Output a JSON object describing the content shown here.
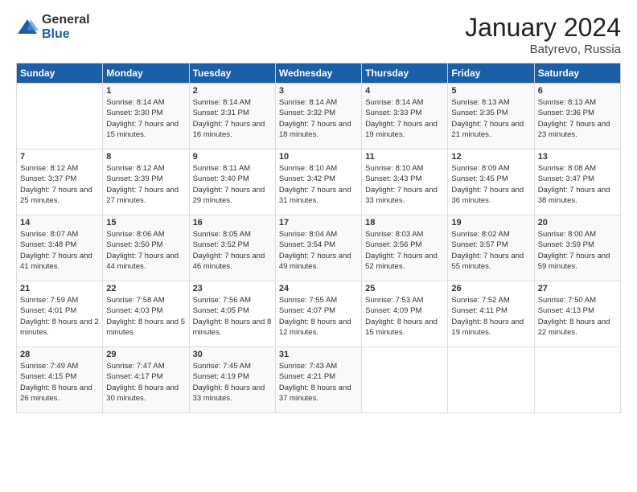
{
  "logo": {
    "general": "General",
    "blue": "Blue"
  },
  "header": {
    "month": "January 2024",
    "location": "Batyrevo, Russia"
  },
  "days_of_week": [
    "Sunday",
    "Monday",
    "Tuesday",
    "Wednesday",
    "Thursday",
    "Friday",
    "Saturday"
  ],
  "weeks": [
    [
      {
        "day": "",
        "sunrise": "",
        "sunset": "",
        "daylight": ""
      },
      {
        "day": "1",
        "sunrise": "Sunrise: 8:14 AM",
        "sunset": "Sunset: 3:30 PM",
        "daylight": "Daylight: 7 hours and 15 minutes."
      },
      {
        "day": "2",
        "sunrise": "Sunrise: 8:14 AM",
        "sunset": "Sunset: 3:31 PM",
        "daylight": "Daylight: 7 hours and 16 minutes."
      },
      {
        "day": "3",
        "sunrise": "Sunrise: 8:14 AM",
        "sunset": "Sunset: 3:32 PM",
        "daylight": "Daylight: 7 hours and 18 minutes."
      },
      {
        "day": "4",
        "sunrise": "Sunrise: 8:14 AM",
        "sunset": "Sunset: 3:33 PM",
        "daylight": "Daylight: 7 hours and 19 minutes."
      },
      {
        "day": "5",
        "sunrise": "Sunrise: 8:13 AM",
        "sunset": "Sunset: 3:35 PM",
        "daylight": "Daylight: 7 hours and 21 minutes."
      },
      {
        "day": "6",
        "sunrise": "Sunrise: 8:13 AM",
        "sunset": "Sunset: 3:36 PM",
        "daylight": "Daylight: 7 hours and 23 minutes."
      }
    ],
    [
      {
        "day": "7",
        "sunrise": "Sunrise: 8:12 AM",
        "sunset": "Sunset: 3:37 PM",
        "daylight": "Daylight: 7 hours and 25 minutes."
      },
      {
        "day": "8",
        "sunrise": "Sunrise: 8:12 AM",
        "sunset": "Sunset: 3:39 PM",
        "daylight": "Daylight: 7 hours and 27 minutes."
      },
      {
        "day": "9",
        "sunrise": "Sunrise: 8:11 AM",
        "sunset": "Sunset: 3:40 PM",
        "daylight": "Daylight: 7 hours and 29 minutes."
      },
      {
        "day": "10",
        "sunrise": "Sunrise: 8:10 AM",
        "sunset": "Sunset: 3:42 PM",
        "daylight": "Daylight: 7 hours and 31 minutes."
      },
      {
        "day": "11",
        "sunrise": "Sunrise: 8:10 AM",
        "sunset": "Sunset: 3:43 PM",
        "daylight": "Daylight: 7 hours and 33 minutes."
      },
      {
        "day": "12",
        "sunrise": "Sunrise: 8:09 AM",
        "sunset": "Sunset: 3:45 PM",
        "daylight": "Daylight: 7 hours and 36 minutes."
      },
      {
        "day": "13",
        "sunrise": "Sunrise: 8:08 AM",
        "sunset": "Sunset: 3:47 PM",
        "daylight": "Daylight: 7 hours and 38 minutes."
      }
    ],
    [
      {
        "day": "14",
        "sunrise": "Sunrise: 8:07 AM",
        "sunset": "Sunset: 3:48 PM",
        "daylight": "Daylight: 7 hours and 41 minutes."
      },
      {
        "day": "15",
        "sunrise": "Sunrise: 8:06 AM",
        "sunset": "Sunset: 3:50 PM",
        "daylight": "Daylight: 7 hours and 44 minutes."
      },
      {
        "day": "16",
        "sunrise": "Sunrise: 8:05 AM",
        "sunset": "Sunset: 3:52 PM",
        "daylight": "Daylight: 7 hours and 46 minutes."
      },
      {
        "day": "17",
        "sunrise": "Sunrise: 8:04 AM",
        "sunset": "Sunset: 3:54 PM",
        "daylight": "Daylight: 7 hours and 49 minutes."
      },
      {
        "day": "18",
        "sunrise": "Sunrise: 8:03 AM",
        "sunset": "Sunset: 3:56 PM",
        "daylight": "Daylight: 7 hours and 52 minutes."
      },
      {
        "day": "19",
        "sunrise": "Sunrise: 8:02 AM",
        "sunset": "Sunset: 3:57 PM",
        "daylight": "Daylight: 7 hours and 55 minutes."
      },
      {
        "day": "20",
        "sunrise": "Sunrise: 8:00 AM",
        "sunset": "Sunset: 3:59 PM",
        "daylight": "Daylight: 7 hours and 59 minutes."
      }
    ],
    [
      {
        "day": "21",
        "sunrise": "Sunrise: 7:59 AM",
        "sunset": "Sunset: 4:01 PM",
        "daylight": "Daylight: 8 hours and 2 minutes."
      },
      {
        "day": "22",
        "sunrise": "Sunrise: 7:58 AM",
        "sunset": "Sunset: 4:03 PM",
        "daylight": "Daylight: 8 hours and 5 minutes."
      },
      {
        "day": "23",
        "sunrise": "Sunrise: 7:56 AM",
        "sunset": "Sunset: 4:05 PM",
        "daylight": "Daylight: 8 hours and 8 minutes."
      },
      {
        "day": "24",
        "sunrise": "Sunrise: 7:55 AM",
        "sunset": "Sunset: 4:07 PM",
        "daylight": "Daylight: 8 hours and 12 minutes."
      },
      {
        "day": "25",
        "sunrise": "Sunrise: 7:53 AM",
        "sunset": "Sunset: 4:09 PM",
        "daylight": "Daylight: 8 hours and 15 minutes."
      },
      {
        "day": "26",
        "sunrise": "Sunrise: 7:52 AM",
        "sunset": "Sunset: 4:11 PM",
        "daylight": "Daylight: 8 hours and 19 minutes."
      },
      {
        "day": "27",
        "sunrise": "Sunrise: 7:50 AM",
        "sunset": "Sunset: 4:13 PM",
        "daylight": "Daylight: 8 hours and 22 minutes."
      }
    ],
    [
      {
        "day": "28",
        "sunrise": "Sunrise: 7:49 AM",
        "sunset": "Sunset: 4:15 PM",
        "daylight": "Daylight: 8 hours and 26 minutes."
      },
      {
        "day": "29",
        "sunrise": "Sunrise: 7:47 AM",
        "sunset": "Sunset: 4:17 PM",
        "daylight": "Daylight: 8 hours and 30 minutes."
      },
      {
        "day": "30",
        "sunrise": "Sunrise: 7:45 AM",
        "sunset": "Sunset: 4:19 PM",
        "daylight": "Daylight: 8 hours and 33 minutes."
      },
      {
        "day": "31",
        "sunrise": "Sunrise: 7:43 AM",
        "sunset": "Sunset: 4:21 PM",
        "daylight": "Daylight: 8 hours and 37 minutes."
      },
      {
        "day": "",
        "sunrise": "",
        "sunset": "",
        "daylight": ""
      },
      {
        "day": "",
        "sunrise": "",
        "sunset": "",
        "daylight": ""
      },
      {
        "day": "",
        "sunrise": "",
        "sunset": "",
        "daylight": ""
      }
    ]
  ]
}
